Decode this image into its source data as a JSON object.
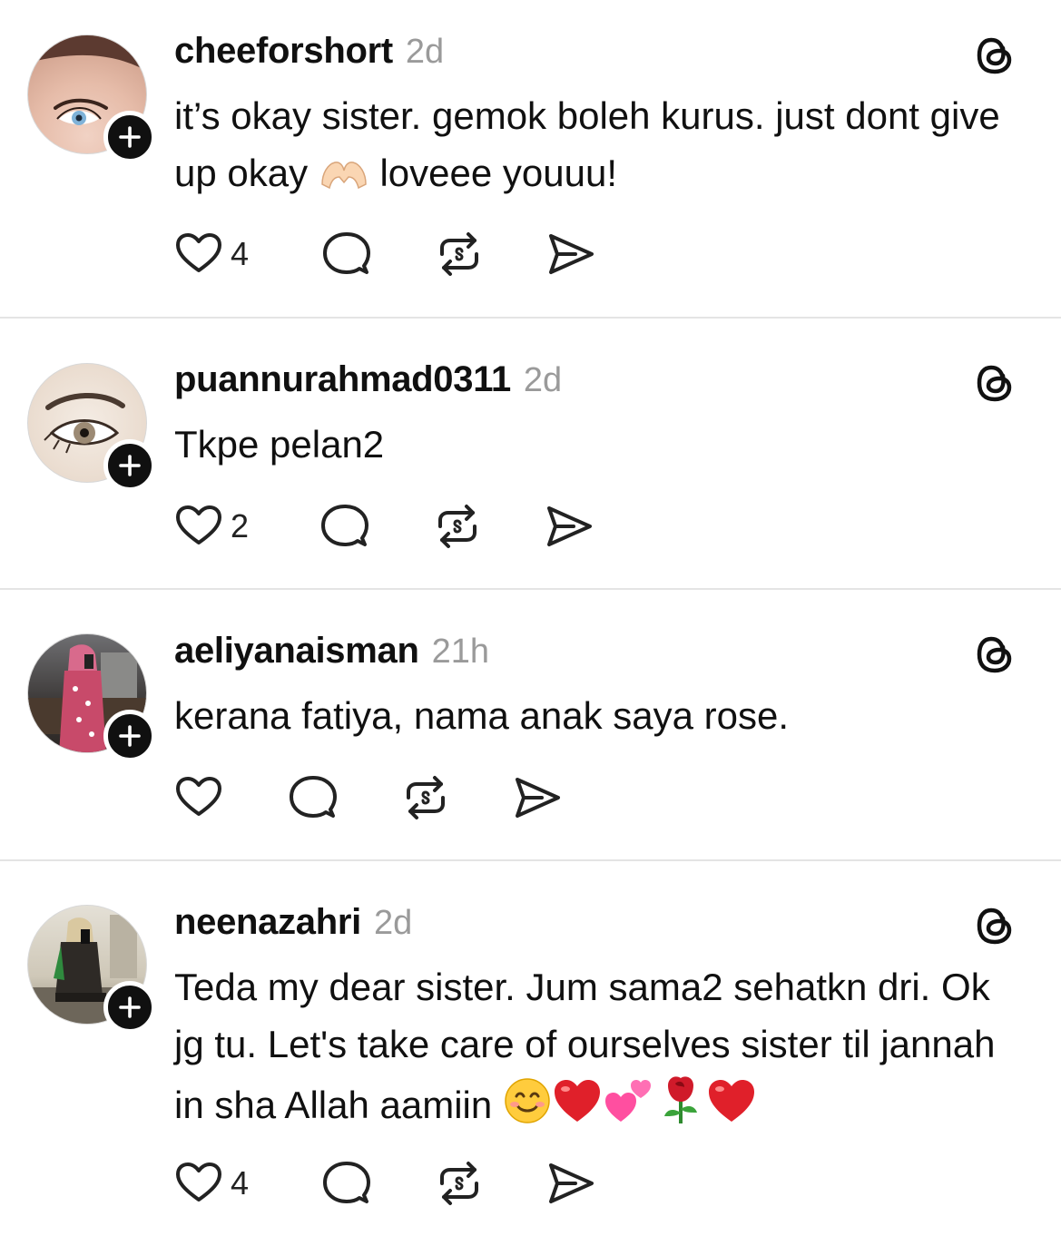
{
  "posts": [
    {
      "username": "cheeforshort",
      "time": "2d",
      "text": "it’s okay sister. gemok boleh kurus. just dont give up okay",
      "text_tail": "loveee youuu!",
      "inline_emoji": "heart-hands",
      "like_count": "4"
    },
    {
      "username": "puannurahmad0311",
      "time": "2d",
      "text": "Tkpe pelan2",
      "like_count": "2"
    },
    {
      "username": "aeliyanaisman",
      "time": "21h",
      "text": "kerana fatiya, nama anak saya rose.",
      "like_count": ""
    },
    {
      "username": "neenazahri",
      "time": "2d",
      "text": "Teda my dear sister. Jum sama2 sehatkn dri. Ok jg tu. Let's take care of ourselves sister til jannah in sha Allah aamiin",
      "trailing_emojis": [
        "smiling-face",
        "red-heart",
        "two-hearts",
        "rose",
        "red-heart"
      ],
      "like_count": "4"
    }
  ],
  "icons": {
    "like": "heart-outline-icon",
    "reply": "speech-bubble-icon",
    "repost": "repost-arrows-icon",
    "share": "send-paper-plane-icon",
    "brand": "threads-logo-icon",
    "follow": "plus-icon"
  },
  "colors": {
    "text": "#101010",
    "muted": "#9a9a9a",
    "divider": "#e4e4e4",
    "background": "#ffffff"
  }
}
